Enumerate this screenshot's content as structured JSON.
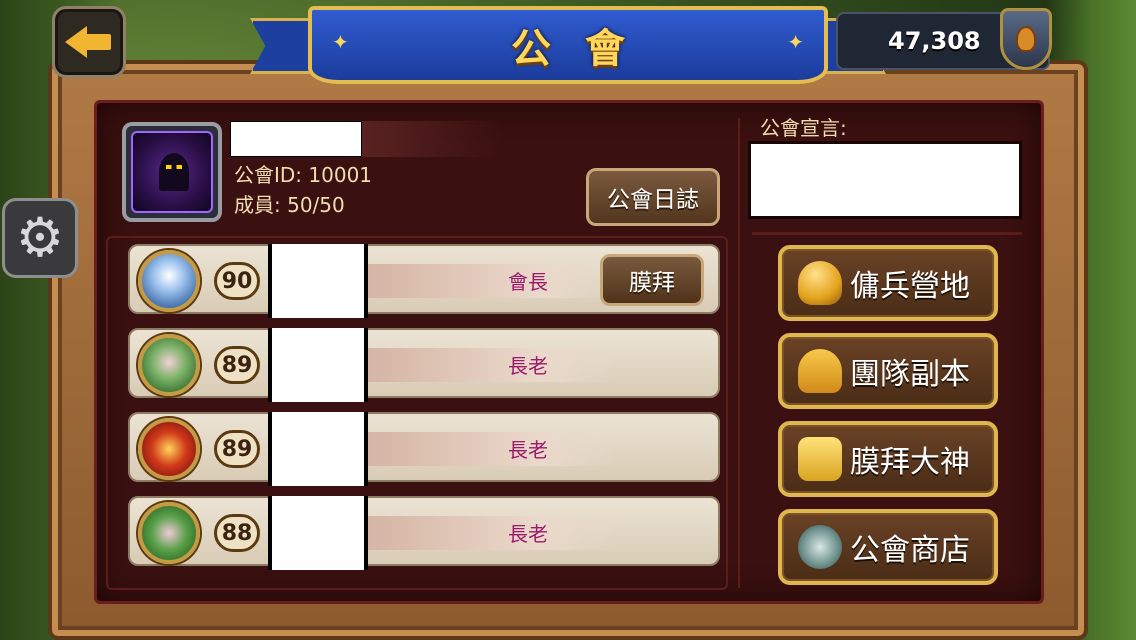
{
  "header": {
    "title": "公會",
    "currency_value": "47,308"
  },
  "guild": {
    "id_text": "公會ID: 10001",
    "members_text": "成員: 50/50",
    "log_button": "公會日誌",
    "announcement_label": "公會宣言:"
  },
  "members": [
    {
      "level": "90",
      "role": "會長",
      "action": "膜拜"
    },
    {
      "level": "89",
      "role": "長老"
    },
    {
      "level": "89",
      "role": "長老"
    },
    {
      "level": "88",
      "role": "長老"
    }
  ],
  "side_buttons": {
    "mercenary": "傭兵營地",
    "raid": "團隊副本",
    "worship": "膜拜大神",
    "shop": "公會商店"
  }
}
